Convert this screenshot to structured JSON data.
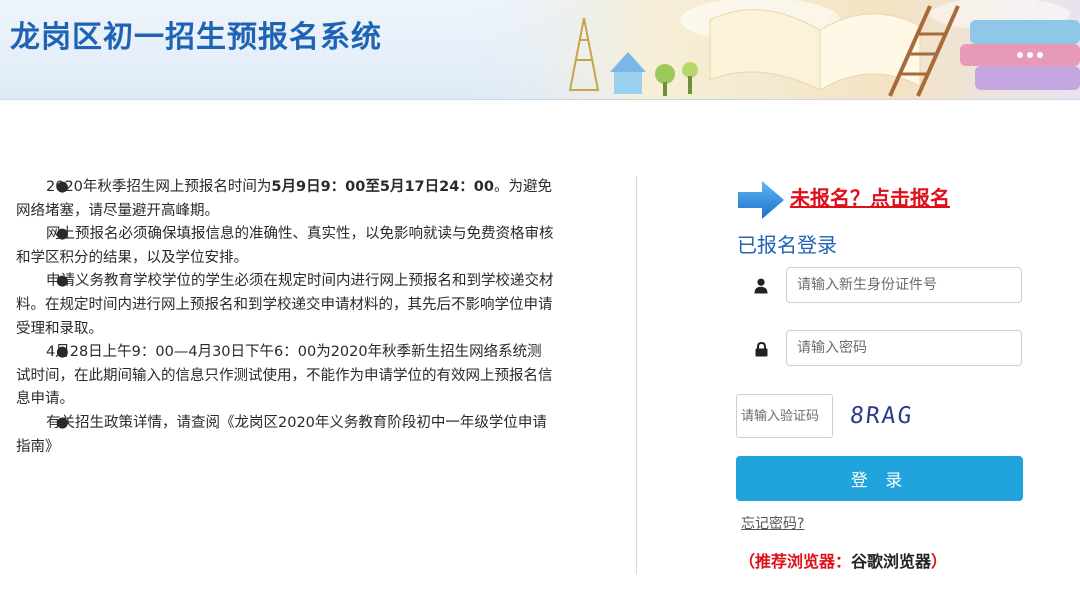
{
  "header": {
    "title": "龙岗区初一招生预报名系统"
  },
  "notices": [
    {
      "parts": [
        {
          "text": "2020年秋季招生网上预报名时间为",
          "bold": false
        },
        {
          "text": "5月9日9：00至5月17日24：00",
          "bold": true
        },
        {
          "text": "。为避免网络堵塞，请尽量避开高峰期。",
          "bold": false
        }
      ]
    },
    {
      "parts": [
        {
          "text": "网上预报名必须确保填报信息的准确性、真实性，以免影响就读与免费资格审核和学区积分的结果，以及学位安排。",
          "bold": false
        }
      ]
    },
    {
      "parts": [
        {
          "text": "申请义务教育学校学位的学生必须在规定时间内进行网上预报名和到学校递交材料。在规定时间内进行网上预报名和到学校递交申请材料的，其先后不影响学位申请受理和录取。",
          "bold": false
        }
      ]
    },
    {
      "parts": [
        {
          "text": "4月28日上午9：00—4月30日下午6：00为2020年秋季新生招生网络系统测试时间，在此期间输入的信息只作测试使用，不能作为申请学位的有效网上预报名信息申请。",
          "bold": false
        }
      ]
    },
    {
      "parts": [
        {
          "text": "有关招生政策详情，请查阅《龙岗区2020年义务教育阶段初中一年级学位申请指南》",
          "bold": false
        }
      ]
    }
  ],
  "bullet": "●",
  "login": {
    "register_link": "未报名？点击报名",
    "heading": "已报名登录",
    "id_placeholder": "请输入新生身份证件号",
    "password_placeholder": "请输入密码",
    "captcha_placeholder": "请输入验证码",
    "captcha_text": "8RAG",
    "login_button": "登 录",
    "forgot_password": "忘记密码?",
    "browser_tip_open": "（",
    "browser_tip_label": "推荐浏览器：",
    "browser_tip_value": "谷歌浏览器",
    "browser_tip_close": "）"
  },
  "icons": {
    "user": "user-icon",
    "lock": "lock-icon",
    "arrow": "arrow-right-icon"
  },
  "colors": {
    "title_blue": "#1f63b4",
    "link_red": "#e0101a",
    "button_blue": "#21a4dc"
  }
}
